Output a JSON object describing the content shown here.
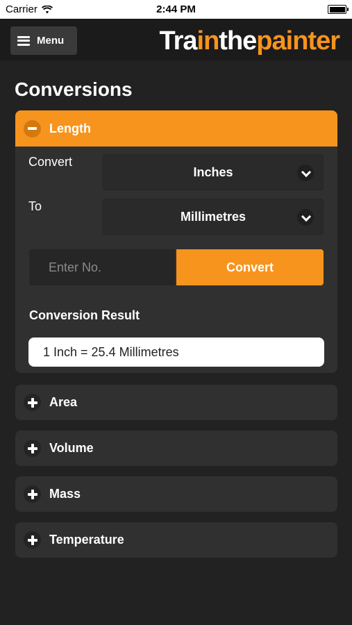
{
  "status_bar": {
    "carrier": "Carrier",
    "time": "2:44 PM"
  },
  "header": {
    "menu_label": "Menu",
    "logo": {
      "part1": "Tra",
      "part2": "in",
      "part3": "the",
      "part4": "painter"
    }
  },
  "page_title": "Conversions",
  "sections": {
    "length": {
      "title": "Length",
      "expanded": true,
      "convert_label": "Convert",
      "from_unit": "Inches",
      "to_label": "To",
      "to_unit": "Millimetres",
      "input_placeholder": "Enter No.",
      "convert_button": "Convert",
      "result_heading": "Conversion Result",
      "result_text": "1 Inch = 25.4 Millimetres"
    },
    "area": {
      "title": "Area"
    },
    "volume": {
      "title": "Volume"
    },
    "mass": {
      "title": "Mass"
    },
    "temperature": {
      "title": "Temperature"
    }
  },
  "colors": {
    "accent": "#f7941d",
    "background": "#222222",
    "panel": "#303030"
  },
  "icons": {
    "menu": "hamburger-icon",
    "expanded": "minus-circle-icon",
    "collapsed": "plus-circle-icon",
    "select": "chevron-down-icon",
    "wifi": "wifi-icon",
    "battery": "battery-icon"
  }
}
